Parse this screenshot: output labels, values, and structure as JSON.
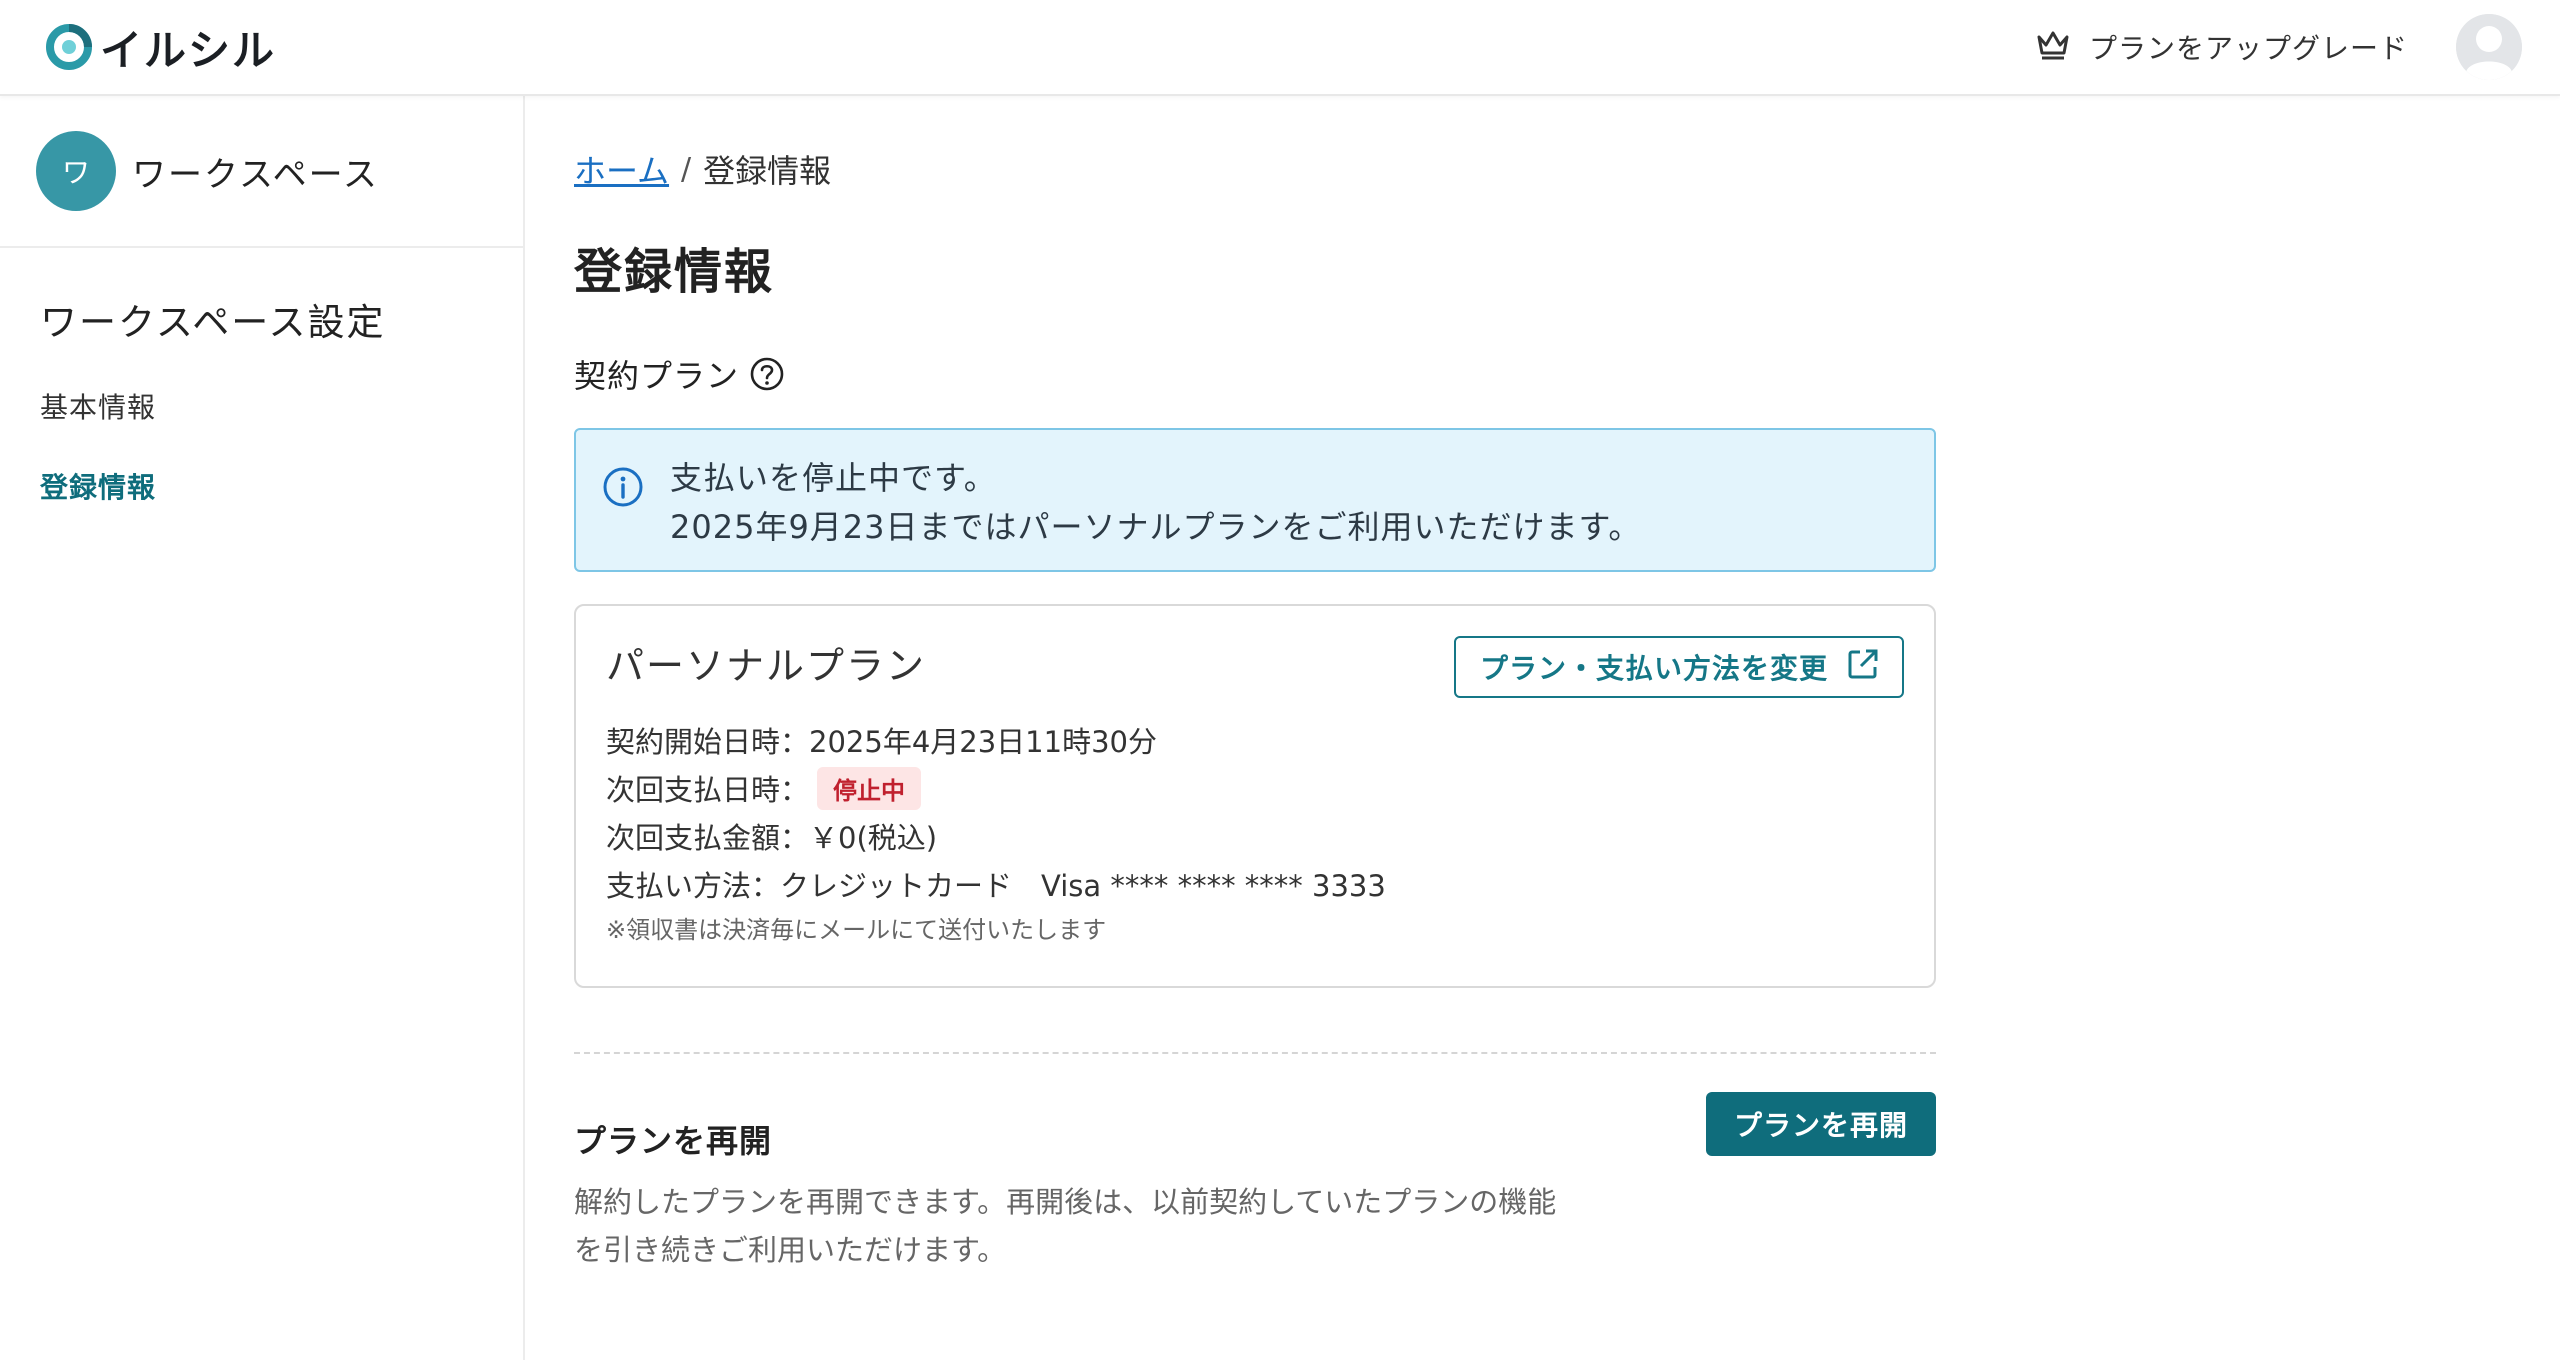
{
  "header": {
    "app_name": "イルシル",
    "logo_icon": "logo-mark-icon",
    "upgrade_icon": "crown-icon",
    "upgrade_label": "プランをアップグレード",
    "user_icon": "user-avatar-icon"
  },
  "sidebar": {
    "workspace_initial": "ワ",
    "workspace_name": "ワークスペース",
    "section_title": "ワークスペース設定",
    "items": [
      {
        "label": "基本情報",
        "active": false
      },
      {
        "label": "登録情報",
        "active": true
      }
    ]
  },
  "breadcrumb": {
    "home": "ホーム",
    "separator": "/",
    "current": "登録情報"
  },
  "page_title": "登録情報",
  "plan_section": {
    "label": "契約プラン",
    "help_icon": "question-circle-icon",
    "alert": {
      "icon": "info-circle-icon",
      "line1": "支払いを停止中です。",
      "line2": "2025年9月23日まではパーソナルプランをご利用いただけます。"
    },
    "card": {
      "plan_name": "パーソナルプラン",
      "change_button": "プラン・支払い方法を変更",
      "change_icon": "external-link-icon",
      "start_label": "契約開始日時：",
      "start_value": "2025年4月23日11時30分",
      "next_pay_date_label": "次回支払日時：",
      "next_pay_date_badge": "停止中",
      "next_amount_label": "次回支払金額：",
      "next_amount_value": "￥0(税込)",
      "payment_method_label": "支払い方法：",
      "payment_method_value": "クレジットカード　Visa **** **** **** 3333",
      "note": "※領収書は決済毎にメールにて送付いたします"
    }
  },
  "resume_section": {
    "title": "プランを再開",
    "description": "解約したプランを再開できます。再開後は、以前契約していたプランの機能を引き続きご利用いただけます。",
    "button": "プランを再開"
  },
  "colors": {
    "accent": "#0f6d7c",
    "link": "#1a6fc2",
    "alert_bg": "#e3f4fc",
    "badge_bg": "#fde5e5",
    "badge_text": "#c0202e"
  }
}
